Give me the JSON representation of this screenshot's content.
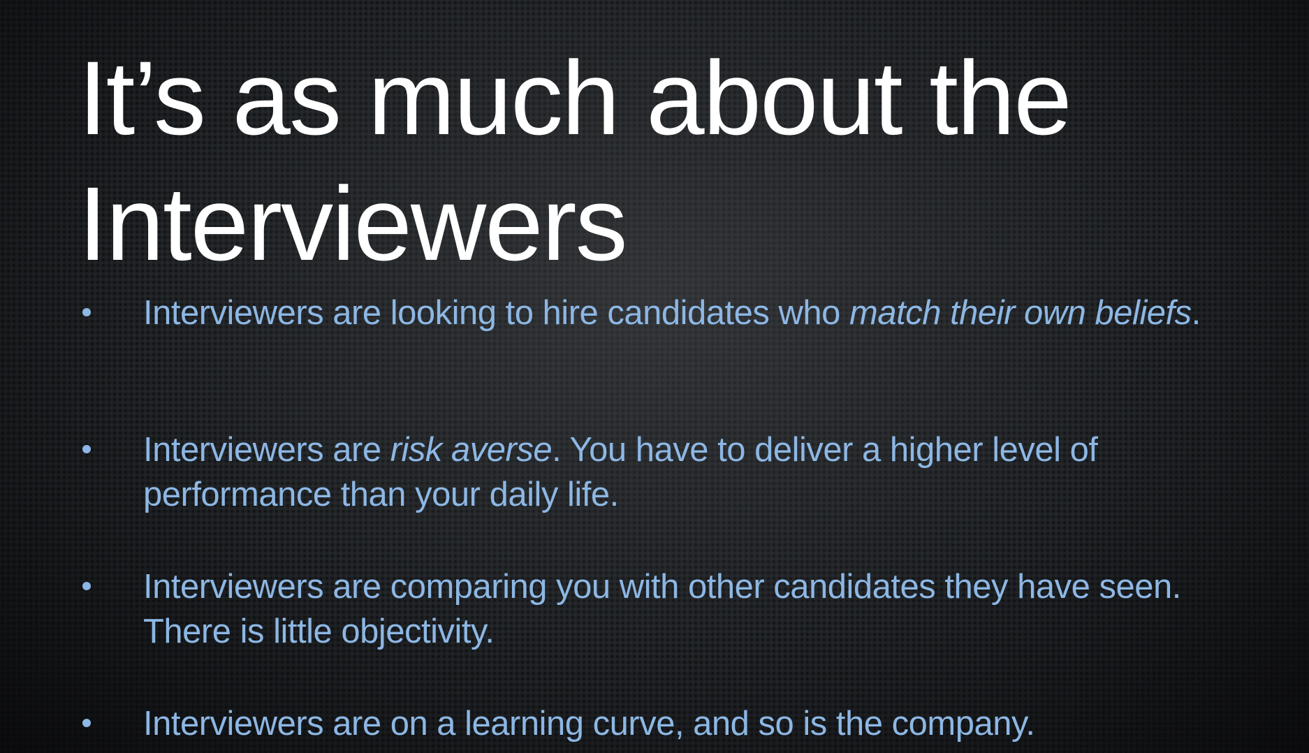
{
  "slide": {
    "title": "It’s as much about the Interviewers",
    "bullets": [
      {
        "pre": "Interviewers are looking to hire candidates who ",
        "emphasis": "match their own beliefs",
        "post": "."
      },
      {
        "pre": "Interviewers are ",
        "emphasis": "risk averse",
        "post": ". You have to deliver a higher level of performance than your daily life."
      },
      {
        "text": "Interviewers are comparing you with other candidates they have seen. There is little objectivity."
      },
      {
        "text": "Interviewers are on a learning curve, and so is the company."
      }
    ]
  },
  "colors": {
    "title": "#ffffff",
    "bullet_text": "#8db7e4",
    "background": "#1e2124"
  }
}
